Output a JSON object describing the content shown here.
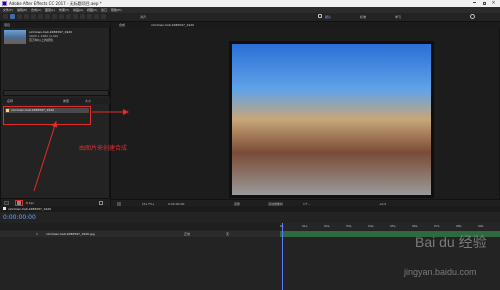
{
  "window": {
    "title": "Adobe After Effects CC 2017 - 无标题项目.aep *"
  },
  "menu": {
    "items": [
      "文件(F)",
      "编辑(E)",
      "合成(C)",
      "图层(L)",
      "效果(T)",
      "动画(A)",
      "视图(V)",
      "窗口",
      "帮助(H)"
    ]
  },
  "toolbar": {
    "mode_label": "默认",
    "other_labels": [
      "对齐",
      "标准",
      "学习"
    ]
  },
  "project_panel": {
    "tab": "项目",
    "preview_name": "old-town-hall-2286597_1920",
    "preview_meta_1": "1920 x 1282 (1.00)",
    "preview_meta_2": "百万种以上的颜色",
    "search_placeholder": "",
    "columns": [
      "名称",
      "类型",
      "大小"
    ],
    "item": "old-town-hall-2286597_1920",
    "footer_label": "8 bpc"
  },
  "composition_panel": {
    "tab": "合成",
    "tab_label": "old-town-hall-2286597_1920",
    "zoom": "(31.7%)",
    "time": "0:00:00:00",
    "quality": "完整",
    "camera": "活动摄像机",
    "views": "1个...",
    "exposure": "+0.0"
  },
  "annotation": {
    "text": "由图片来创建合成"
  },
  "timeline": {
    "tab": "old-town-hall-2286597_1920",
    "timecode": "0:00:00:00",
    "layer_number": "1",
    "layer_name": "old-town-hall-2286597_1920.jpg",
    "mode": "正常",
    "parent": "无",
    "ruler_labels": [
      "0s",
      "01s",
      "02s",
      "03s",
      "04s",
      "05s",
      "06s",
      "07s",
      "08s",
      "09s"
    ]
  },
  "watermark": {
    "brand": "Bai du 经验",
    "url": "jingyan.baidu.com"
  },
  "colors": {
    "accent": "#3f6da8",
    "annotation": "#e22b2b",
    "timeline_bar": "#2f6a3f",
    "cti": "#5b7cff"
  }
}
